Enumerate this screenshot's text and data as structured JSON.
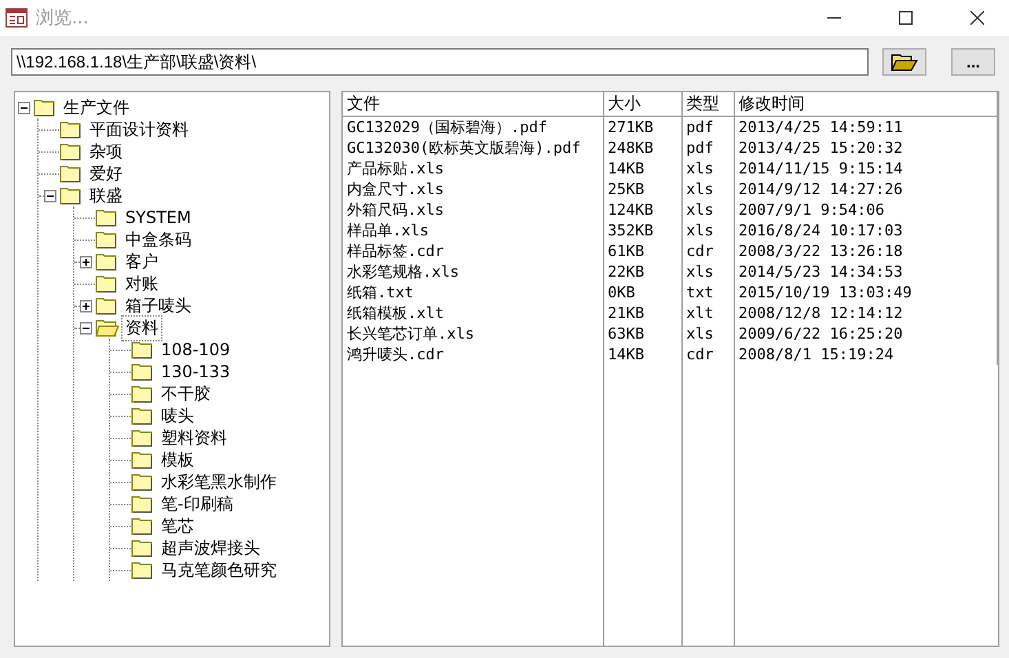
{
  "window": {
    "title": "浏览..."
  },
  "path_field": {
    "value": "\\\\192.168.1.18\\生产部\\联盛\\资料\\"
  },
  "tree": [
    {
      "label": "生产文件",
      "expanded": true,
      "selected": false,
      "children": [
        {
          "label": "平面设计资料",
          "selected": false
        },
        {
          "label": "杂项",
          "selected": false
        },
        {
          "label": "爱好",
          "selected": false
        },
        {
          "label": "联盛",
          "expanded": true,
          "selected": false,
          "children": [
            {
              "label": "SYSTEM",
              "selected": false
            },
            {
              "label": "中盒条码",
              "selected": false
            },
            {
              "label": "客户",
              "expanded": false,
              "selected": false
            },
            {
              "label": "对账",
              "selected": false
            },
            {
              "label": "箱子唛头",
              "expanded": false,
              "selected": false
            },
            {
              "label": "资料",
              "expanded": true,
              "selected": true,
              "children": [
                {
                  "label": "108-109",
                  "selected": false
                },
                {
                  "label": "130-133",
                  "selected": false
                },
                {
                  "label": "不干胶",
                  "selected": false
                },
                {
                  "label": "唛头",
                  "selected": false
                },
                {
                  "label": "塑料资料",
                  "selected": false
                },
                {
                  "label": "模板",
                  "selected": false
                },
                {
                  "label": "水彩笔黑水制作",
                  "selected": false
                },
                {
                  "label": "笔-印刷稿",
                  "selected": false
                },
                {
                  "label": "笔芯",
                  "selected": false
                },
                {
                  "label": "超声波焊接头",
                  "selected": false
                },
                {
                  "label": "马克笔颜色研究",
                  "selected": false
                }
              ]
            }
          ]
        }
      ]
    }
  ],
  "table": {
    "columns": [
      "文件",
      "大小",
      "类型",
      "修改时间"
    ],
    "rows": [
      [
        "GC132029（国标碧海）.pdf",
        "271KB",
        "pdf",
        "2013/4/25 14:59:11"
      ],
      [
        "GC132030(欧标英文版碧海).pdf",
        "248KB",
        "pdf",
        "2013/4/25 15:20:32"
      ],
      [
        "产品标贴.xls",
        "14KB",
        "xls",
        "2014/11/15 9:15:14"
      ],
      [
        "内盒尺寸.xls",
        "25KB",
        "xls",
        "2014/9/12 14:27:26"
      ],
      [
        "外箱尺码.xls",
        "124KB",
        "xls",
        "2007/9/1 9:54:06"
      ],
      [
        "样品单.xls",
        "352KB",
        "xls",
        "2016/8/24 10:17:03"
      ],
      [
        "样品标签.cdr",
        "61KB",
        "cdr",
        "2008/3/22 13:26:18"
      ],
      [
        "水彩笔规格.xls",
        "22KB",
        "xls",
        "2014/5/23 14:34:53"
      ],
      [
        "纸箱.txt",
        "0KB",
        "txt",
        "2015/10/19 13:03:49"
      ],
      [
        "纸箱模板.xlt",
        "21KB",
        "xlt",
        "2008/12/8 12:14:12"
      ],
      [
        "长兴笔芯订单.xls",
        "63KB",
        "xls",
        "2009/6/22 16:25:20"
      ],
      [
        "鸿升唛头.cdr",
        "14KB",
        "cdr",
        "2008/8/1 15:19:24"
      ]
    ]
  },
  "more_button": {
    "label": "..."
  }
}
